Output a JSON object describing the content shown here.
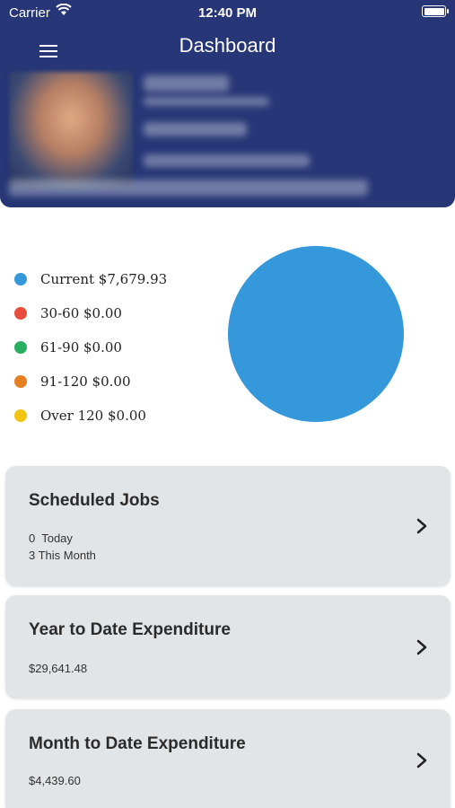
{
  "status_bar": {
    "carrier": "Carrier",
    "time": "12:40 PM"
  },
  "header": {
    "title": "Dashboard"
  },
  "legend": [
    {
      "label": "Current $7,679.93",
      "color": "#3498db"
    },
    {
      "label": "30-60 $0.00",
      "color": "#e74c3c"
    },
    {
      "label": "61-90 $0.00",
      "color": "#27ae60"
    },
    {
      "label": "91-120 $0.00",
      "color": "#e67e22"
    },
    {
      "label": "Over 120 $0.00",
      "color": "#f1c40f"
    }
  ],
  "pie": {
    "slices": [
      {
        "label": "Current",
        "value": 7679.93,
        "color": "#3498db"
      }
    ]
  },
  "cards": {
    "scheduled_jobs": {
      "title": "Scheduled Jobs",
      "today": "0  Today",
      "month": "3 This Month"
    },
    "ytd": {
      "title": "Year to Date Expenditure",
      "value": "$29,641.48"
    },
    "mtd": {
      "title": "Month to Date Expenditure",
      "value": "$4,439.60"
    }
  }
}
